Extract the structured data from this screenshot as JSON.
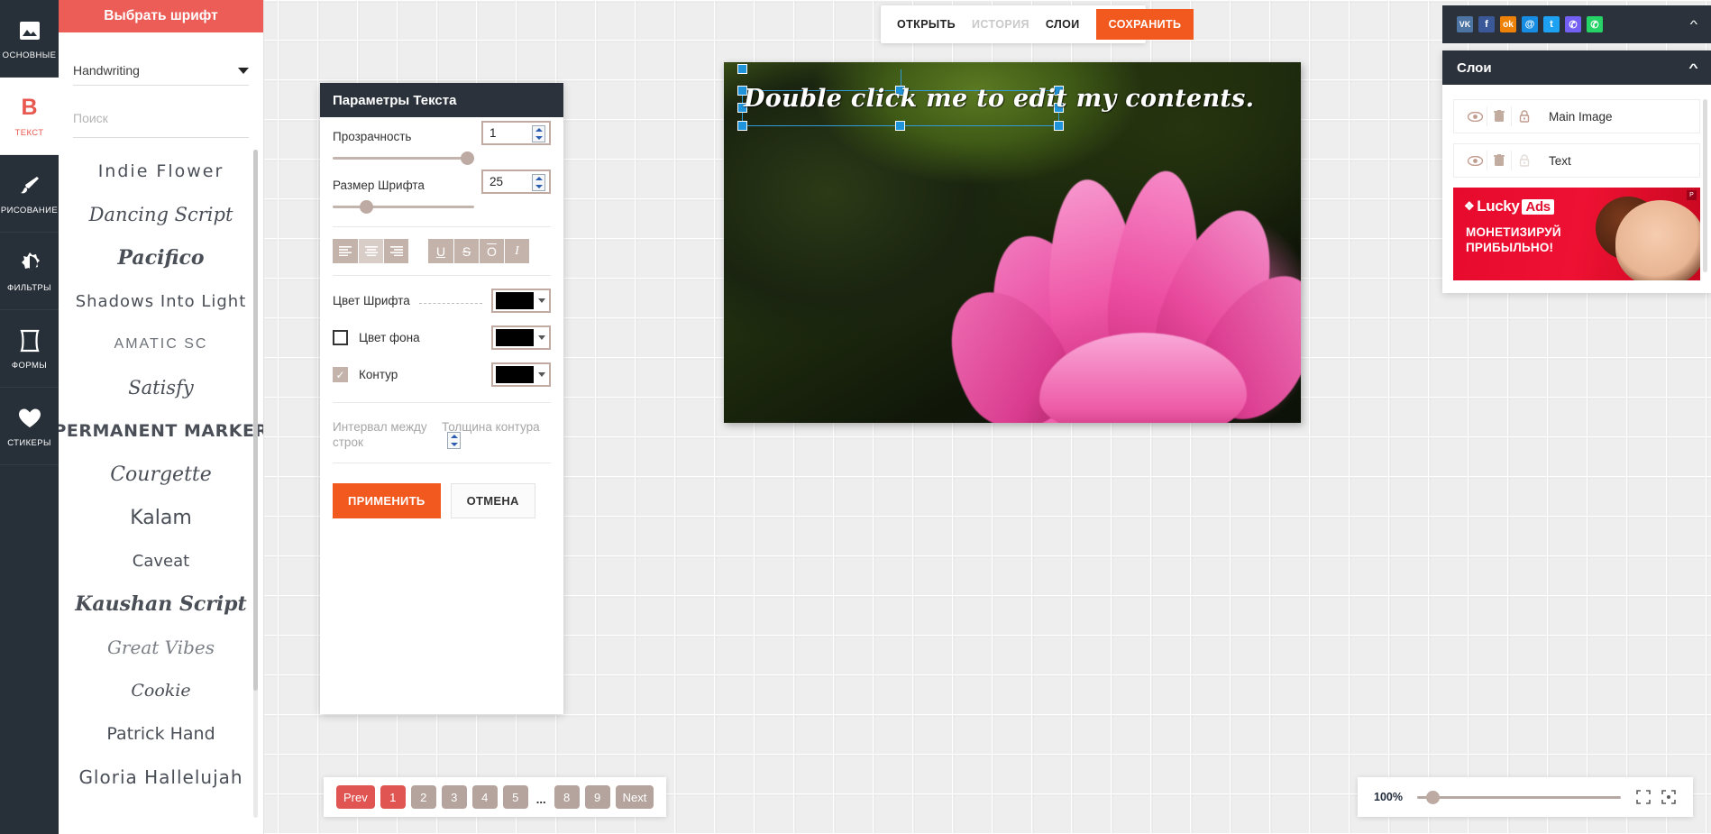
{
  "rail": {
    "items": [
      {
        "label": "ОСНОВНЫЕ",
        "icon": "image-icon",
        "active": false
      },
      {
        "label": "ТЕКСТ",
        "icon": "bold-b-icon",
        "active": true
      },
      {
        "label": "РИСОВАНИЕ",
        "icon": "brush-icon",
        "active": false
      },
      {
        "label": "ФИЛЬТРЫ",
        "icon": "contrast-icon",
        "active": false
      },
      {
        "label": "ФОРМЫ",
        "icon": "shape-icon",
        "active": false
      },
      {
        "label": "СТИКЕРЫ",
        "icon": "heart-icon",
        "active": false
      }
    ]
  },
  "font_panel": {
    "header": "Выбрать шрифт",
    "category_value": "Handwriting",
    "search_placeholder": "Поиск",
    "fonts": [
      "Indie Flower",
      "Dancing Script",
      "Pacifico",
      "Shadows Into Light",
      "AMATIC SC",
      "Satisfy",
      "PERMANENT MARKER",
      "Courgette",
      "Kalam",
      "Caveat",
      "Kaushan Script",
      "Great Vibes",
      "Cookie",
      "Patrick Hand",
      "Gloria Hallelujah"
    ]
  },
  "text_params": {
    "title": "Параметры Текста",
    "opacity_label": "Прозрачность",
    "opacity_value": "1",
    "fontsize_label": "Размер Шрифта",
    "fontsize_value": "25",
    "align_buttons": [
      {
        "name": "align-left",
        "glyph": "≡",
        "selected": false
      },
      {
        "name": "align-center",
        "glyph": "≡",
        "selected": true
      },
      {
        "name": "align-right",
        "glyph": "≡",
        "selected": false
      }
    ],
    "style_buttons": [
      {
        "name": "underline",
        "glyph": "U",
        "selected": false
      },
      {
        "name": "strikethrough",
        "glyph": "S",
        "selected": false
      },
      {
        "name": "overline",
        "glyph": "O",
        "selected": false
      },
      {
        "name": "italic",
        "glyph": "I",
        "selected": false
      }
    ],
    "font_color_label": "Цвет Шрифта",
    "font_color_value": "#000000",
    "bg_color_label": "Цвет фона",
    "bg_color_value": "#000000",
    "bg_color_checked": false,
    "outline_label": "Контур",
    "outline_color_value": "#000000",
    "outline_checked": true,
    "line_spacing_label": "Интервал между строк",
    "outline_width_label": "Толщина контура",
    "apply_label": "ПРИМЕНИТЬ",
    "cancel_label": "ОТМЕНА"
  },
  "toolbar": {
    "open_label": "ОТКРЫТЬ",
    "history_label": "ИСТОРИЯ",
    "layers_label": "СЛОИ",
    "save_label": "СОХРАНИТЬ",
    "save_color": "#f2591f"
  },
  "canvas": {
    "text": "Double click me to edit my contents."
  },
  "right_panel": {
    "share_icons": [
      {
        "name": "vk-icon",
        "glyph": "VK",
        "color": "#4c75a3"
      },
      {
        "name": "facebook-icon",
        "glyph": "f",
        "color": "#3b5998"
      },
      {
        "name": "odnoklassniki-icon",
        "glyph": "ok",
        "color": "#ee8208"
      },
      {
        "name": "mailru-icon",
        "glyph": "@",
        "color": "#168de2"
      },
      {
        "name": "twitter-icon",
        "glyph": "t",
        "color": "#1da1f2"
      },
      {
        "name": "viber-icon",
        "glyph": "V",
        "color": "#7360f2"
      },
      {
        "name": "whatsapp-icon",
        "glyph": "W",
        "color": "#25d366"
      }
    ],
    "layers_title": "Слои",
    "layers": [
      {
        "name": "Main Image",
        "locked": true
      },
      {
        "name": "Text",
        "locked": false
      }
    ],
    "ad": {
      "brand_left": "Lucky",
      "brand_badge": "Ads",
      "line1": "МОНЕТИЗИРУЙ",
      "line2": "ПРИБЫЛЬНО!",
      "corner_mark": "Р"
    }
  },
  "pagination": {
    "prev": "Prev",
    "pages": [
      "1",
      "2",
      "3",
      "4",
      "5"
    ],
    "ellipsis": "...",
    "tail_pages": [
      "8",
      "9"
    ],
    "next": "Next",
    "active": "1"
  },
  "zoom": {
    "level": "100%",
    "fit_icon": "expand-icon",
    "center_icon": "focus-icon"
  }
}
